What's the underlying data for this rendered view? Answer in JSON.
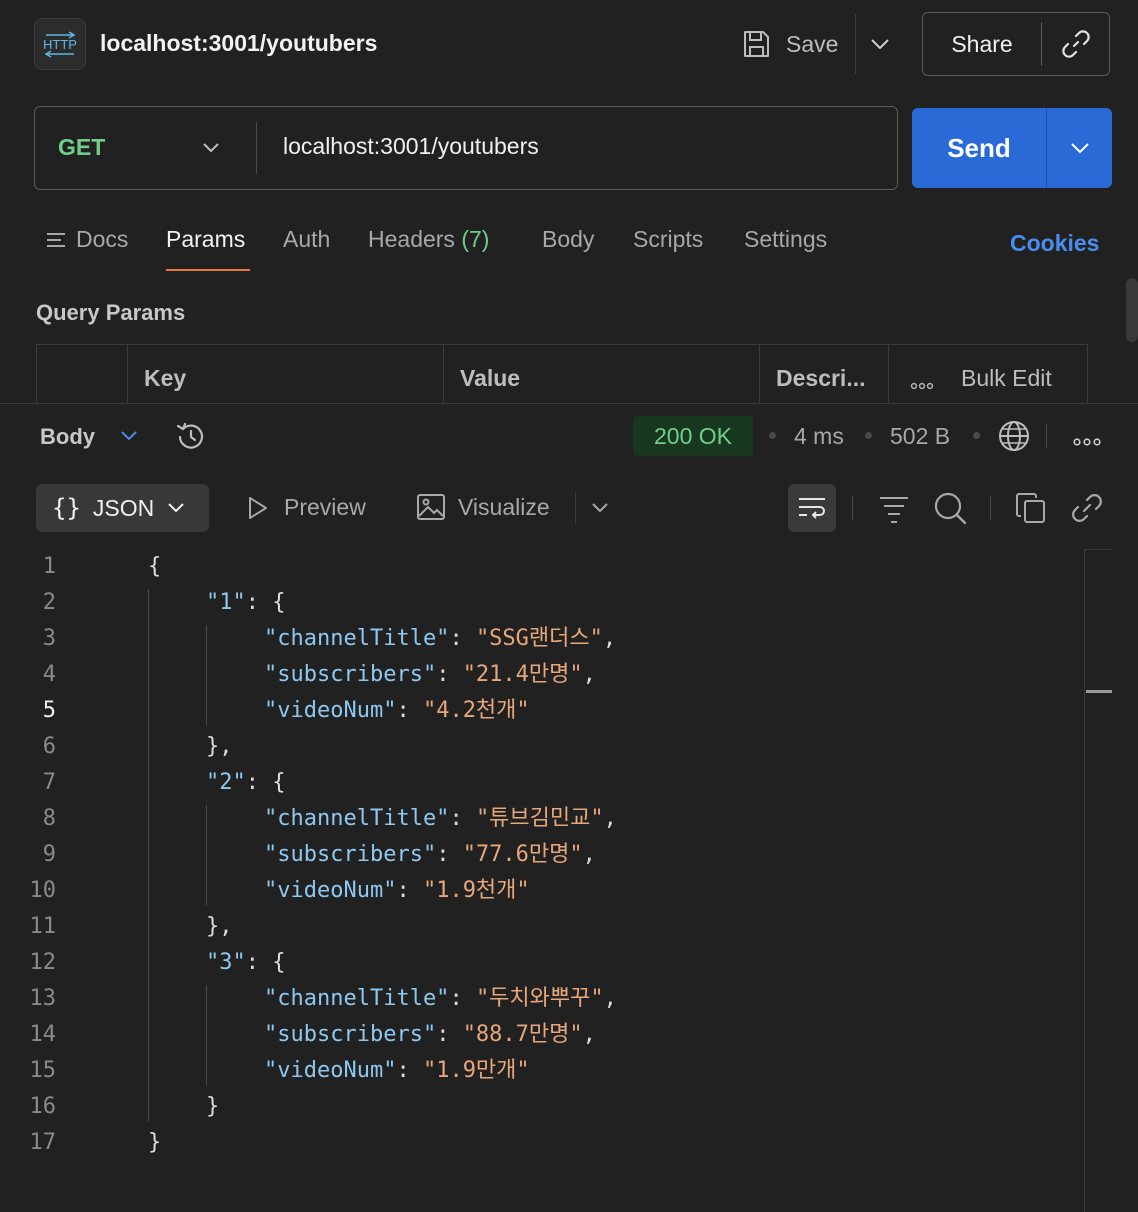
{
  "header": {
    "badge_text": "HTTP",
    "title": "localhost:3001/youtubers",
    "save_label": "Save",
    "share_label": "Share"
  },
  "request": {
    "method": "GET",
    "url": "localhost:3001/youtubers",
    "send_label": "Send"
  },
  "tabs": {
    "docs": "Docs",
    "params": "Params",
    "auth": "Auth",
    "headers": "Headers",
    "headers_count": "(7)",
    "body": "Body",
    "scripts": "Scripts",
    "settings": "Settings",
    "active": "Params",
    "cookies": "Cookies"
  },
  "query_params": {
    "title": "Query Params",
    "columns": [
      "Key",
      "Value",
      "Descri..."
    ],
    "bulk_edit": "Bulk Edit"
  },
  "response": {
    "body_label": "Body",
    "status": "200 OK",
    "time": "4 ms",
    "size": "502 B"
  },
  "toolbar": {
    "json_label": "JSON",
    "preview_label": "Preview",
    "visualize_label": "Visualize"
  },
  "code": {
    "current_line": 5,
    "lines": [
      [
        [
          "p",
          "{"
        ]
      ],
      [
        [
          "k",
          "\"1\""
        ],
        [
          "p",
          ": {"
        ]
      ],
      [
        [
          "k",
          "\"channelTitle\""
        ],
        [
          "p",
          ": "
        ],
        [
          "s",
          "\"SSG랜더스\""
        ],
        [
          "p",
          ","
        ]
      ],
      [
        [
          "k",
          "\"subscribers\""
        ],
        [
          "p",
          ": "
        ],
        [
          "s",
          "\"21.4만명\""
        ],
        [
          "p",
          ","
        ]
      ],
      [
        [
          "k",
          "\"videoNum\""
        ],
        [
          "p",
          ": "
        ],
        [
          "s",
          "\"4.2천개\""
        ]
      ],
      [
        [
          "p",
          "},"
        ]
      ],
      [
        [
          "k",
          "\"2\""
        ],
        [
          "p",
          ": {"
        ]
      ],
      [
        [
          "k",
          "\"channelTitle\""
        ],
        [
          "p",
          ": "
        ],
        [
          "s",
          "\"튜브김민교\""
        ],
        [
          "p",
          ","
        ]
      ],
      [
        [
          "k",
          "\"subscribers\""
        ],
        [
          "p",
          ": "
        ],
        [
          "s",
          "\"77.6만명\""
        ],
        [
          "p",
          ","
        ]
      ],
      [
        [
          "k",
          "\"videoNum\""
        ],
        [
          "p",
          ": "
        ],
        [
          "s",
          "\"1.9천개\""
        ]
      ],
      [
        [
          "p",
          "},"
        ]
      ],
      [
        [
          "k",
          "\"3\""
        ],
        [
          "p",
          ": {"
        ]
      ],
      [
        [
          "k",
          "\"channelTitle\""
        ],
        [
          "p",
          ": "
        ],
        [
          "s",
          "\"두치와뿌꾸\""
        ],
        [
          "p",
          ","
        ]
      ],
      [
        [
          "k",
          "\"subscribers\""
        ],
        [
          "p",
          ": "
        ],
        [
          "s",
          "\"88.7만명\""
        ],
        [
          "p",
          ","
        ]
      ],
      [
        [
          "k",
          "\"videoNum\""
        ],
        [
          "p",
          ": "
        ],
        [
          "s",
          "\"1.9만개\""
        ]
      ],
      [
        [
          "p",
          "}"
        ]
      ],
      [
        [
          "p",
          "}"
        ]
      ]
    ],
    "indents": [
      0,
      1,
      2,
      2,
      2,
      1,
      1,
      2,
      2,
      2,
      1,
      1,
      2,
      2,
      2,
      1,
      0
    ]
  },
  "colors": {
    "accent": "#2a6ad6",
    "status_ok": "#6fcf8a",
    "tab_underline": "#e8773e",
    "cookies": "#4a8df0",
    "json_key": "#8ec8f0",
    "json_string": "#e8a77a"
  },
  "icons": {
    "badge": "http-icon",
    "save": "floppy-disk-icon",
    "share": "link-icon",
    "history": "history-icon",
    "network": "globe-icon",
    "preview": "play-icon",
    "visualize": "image-icon",
    "wrap": "word-wrap-icon",
    "filter": "filter-icon",
    "search": "search-icon",
    "copy": "copy-icon",
    "link": "link-icon"
  }
}
